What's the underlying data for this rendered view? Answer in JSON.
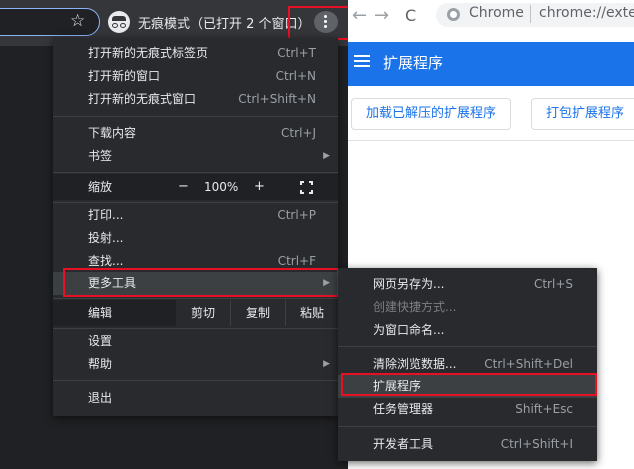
{
  "left_window": {
    "incognito_label": "无痕模式（已打开 2 个窗口）"
  },
  "right_window": {
    "back_arrow": "←",
    "forward_arrow": "→",
    "reload": "C",
    "omnibox_site": "Chrome",
    "omnibox_url": "chrome://exte",
    "header_title": "扩展程序",
    "load_unpacked_label": "加载已解压的扩展程序",
    "pack_extension_label": "打包扩展程序"
  },
  "menu": {
    "items_top": [
      {
        "label": "打开新的无痕式标签页",
        "shortcut": "Ctrl+T"
      },
      {
        "label": "打开新的窗口",
        "shortcut": "Ctrl+N"
      },
      {
        "label": "打开新的无痕式窗口",
        "shortcut": "Ctrl+Shift+N"
      }
    ],
    "downloads": {
      "label": "下载内容",
      "shortcut": "Ctrl+J"
    },
    "bookmarks": {
      "label": "书签"
    },
    "zoom": {
      "label": "缩放",
      "minus": "−",
      "value": "100%",
      "plus": "+"
    },
    "print": {
      "label": "打印...",
      "shortcut": "Ctrl+P"
    },
    "cast": {
      "label": "投射..."
    },
    "find": {
      "label": "查找...",
      "shortcut": "Ctrl+F"
    },
    "more_tools": {
      "label": "更多工具"
    },
    "edit": {
      "label": "编辑",
      "cut": "剪切",
      "copy": "复制",
      "paste": "粘贴"
    },
    "settings": {
      "label": "设置"
    },
    "help": {
      "label": "帮助"
    },
    "exit": {
      "label": "退出"
    }
  },
  "submenu": {
    "save_page": {
      "label": "网页另存为...",
      "shortcut": "Ctrl+S"
    },
    "create_shortcut": {
      "label": "创建快捷方式..."
    },
    "name_window": {
      "label": "为窗口命名..."
    },
    "clear_data": {
      "label": "清除浏览数据...",
      "shortcut": "Ctrl+Shift+Del"
    },
    "extensions": {
      "label": "扩展程序"
    },
    "task_manager": {
      "label": "任务管理器",
      "shortcut": "Shift+Esc"
    },
    "dev_tools": {
      "label": "开发者工具",
      "shortcut": "Ctrl+Shift+I"
    }
  },
  "colors": {
    "highlight_outline": "#e81123",
    "header_blue": "#1a73e8",
    "menu_bg": "#292a2d"
  }
}
